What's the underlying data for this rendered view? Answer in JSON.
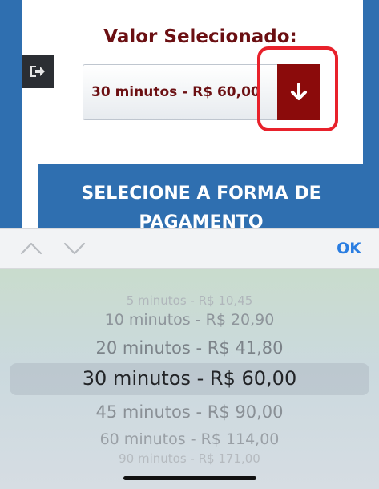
{
  "header": {
    "title": "Valor Selecionado:"
  },
  "select": {
    "value": "30 minutos - R$ 60,00"
  },
  "payment_button": {
    "line1": "SELECIONE A FORMA DE",
    "line2": "PAGAMENTO"
  },
  "toolbar": {
    "ok_label": "OK"
  },
  "picker": {
    "items": [
      "5 minutos - R$ 10,45",
      "10 minutos - R$ 20,90",
      "20 minutos - R$ 41,80",
      "30 minutos - R$ 60,00",
      "45 minutos - R$ 90,00",
      "60 minutos - R$ 114,00",
      "90 minutos - R$ 171,00"
    ],
    "selected_index": 3
  },
  "colors": {
    "primary_blue": "#2f6fb0",
    "dark_red": "#8b0b0b",
    "title_red": "#6b0f12",
    "ok_blue": "#2a7de1",
    "highlight_red": "#e8212b"
  }
}
